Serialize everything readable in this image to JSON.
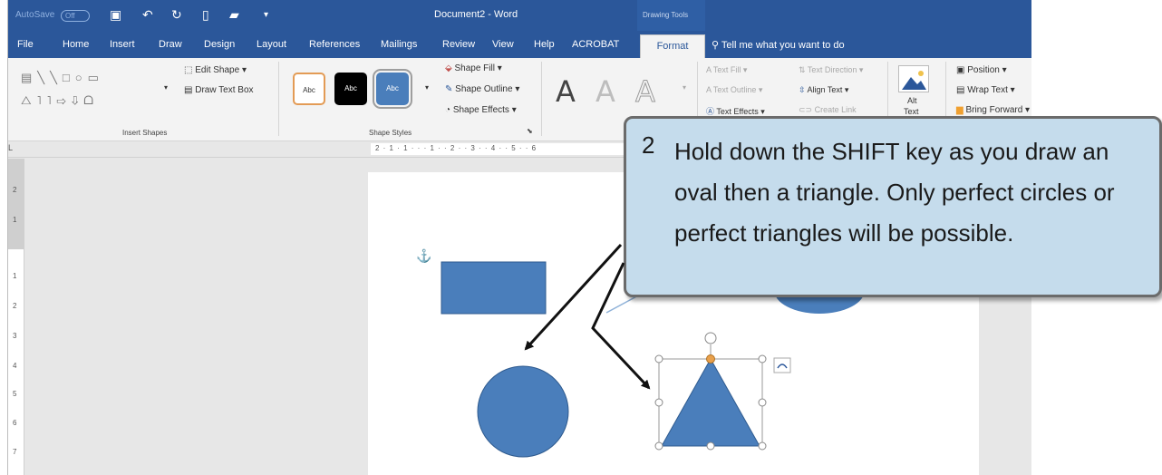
{
  "titlebar": {
    "autosave": "AutoSave",
    "autosave_state": "Off",
    "doc_title": "Document2 - Word",
    "context_label": "Drawing Tools"
  },
  "tabs": [
    "File",
    "Home",
    "Insert",
    "Draw",
    "Design",
    "Layout",
    "References",
    "Mailings",
    "Review",
    "View",
    "Help",
    "ACROBAT"
  ],
  "active_tab": "Format",
  "tell_me": "Tell me what you want to do",
  "ribbon": {
    "edit_shape": "Edit Shape",
    "draw_text_box": "Draw Text Box",
    "insert_shapes_label": "Insert Shapes",
    "style_abc": "Abc",
    "shape_fill": "Shape Fill",
    "shape_outline": "Shape Outline",
    "shape_effects": "Shape Effects",
    "shape_styles_label": "Shape Styles",
    "wordart_a": "A",
    "text_fill": "Text Fill",
    "text_outline": "Text Outline",
    "text_effects": "Text Effects",
    "text_direction": "Text Direction",
    "align_text": "Align Text",
    "create_link": "Create Link",
    "alt_text_1": "Alt",
    "alt_text_2": "Text",
    "position": "Position",
    "wrap_text": "Wrap Text",
    "bring_forward": "Bring Forward"
  },
  "ruler": {
    "horizontal_marks": "2 · 1 · 1 · · · 1 · · 2 · · 3 · · 4 · · 5 · · 6",
    "vertical_marks": [
      "2",
      "1",
      "1",
      "2",
      "3",
      "4",
      "5",
      "6",
      "7"
    ],
    "corner": "L"
  },
  "callout": {
    "number": "2",
    "text": "Hold down the SHIFT key as you draw an oval then a triangle. Only perfect circles or perfect triangles will be possible."
  },
  "colors": {
    "title_blue": "#2b579a",
    "shape_blue": "#4a7ebb",
    "callout_bg": "#c5dcec",
    "handle_orange": "#e8a04c"
  }
}
